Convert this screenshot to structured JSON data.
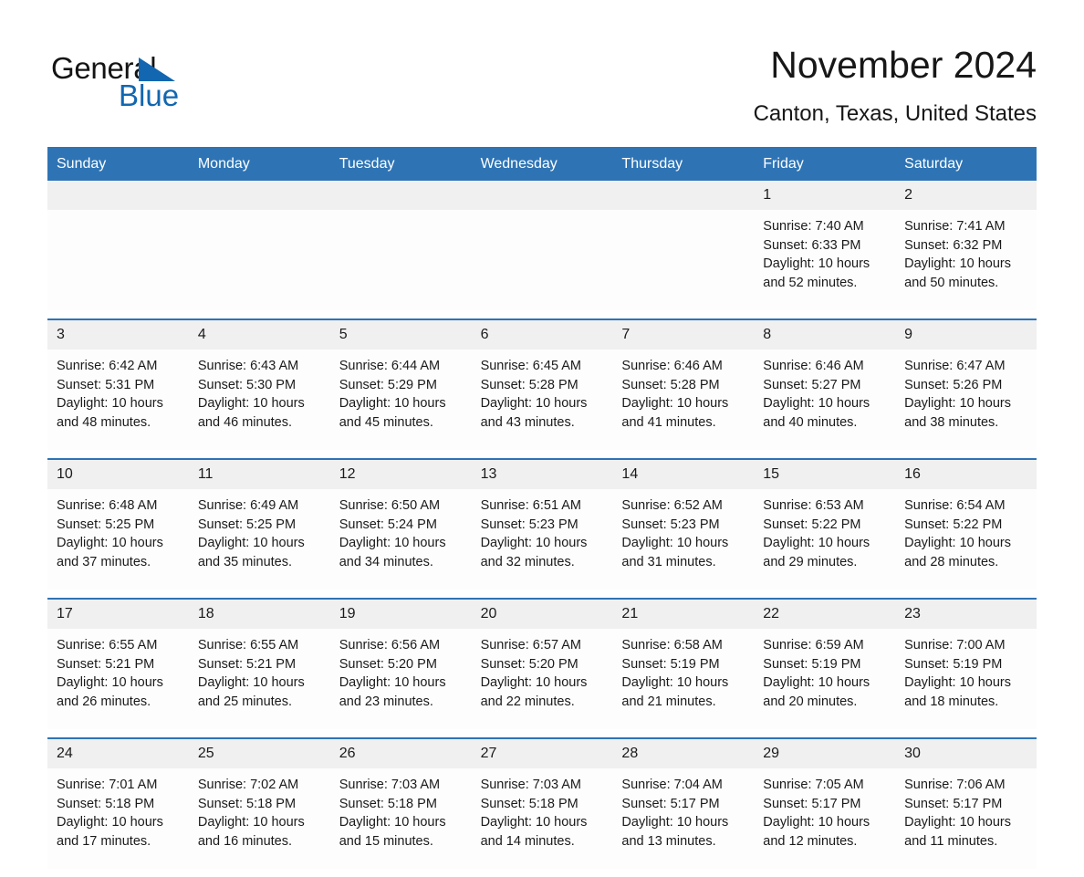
{
  "brand": {
    "name_part1": "General",
    "name_part2": "Blue",
    "accent_color": "#1267b0"
  },
  "header": {
    "title": "November 2024",
    "subtitle": "Canton, Texas, United States",
    "header_bg_color": "#2e74b5",
    "daynum_bg_color": "#f0f0f0"
  },
  "weekday_headers": [
    "Sunday",
    "Monday",
    "Tuesday",
    "Wednesday",
    "Thursday",
    "Friday",
    "Saturday"
  ],
  "weeks": [
    {
      "days": [
        {
          "num": "",
          "lines": []
        },
        {
          "num": "",
          "lines": []
        },
        {
          "num": "",
          "lines": []
        },
        {
          "num": "",
          "lines": []
        },
        {
          "num": "",
          "lines": []
        },
        {
          "num": "1",
          "lines": [
            "Sunrise: 7:40 AM",
            "Sunset: 6:33 PM",
            "Daylight: 10 hours",
            "and 52 minutes."
          ]
        },
        {
          "num": "2",
          "lines": [
            "Sunrise: 7:41 AM",
            "Sunset: 6:32 PM",
            "Daylight: 10 hours",
            "and 50 minutes."
          ]
        }
      ]
    },
    {
      "days": [
        {
          "num": "3",
          "lines": [
            "Sunrise: 6:42 AM",
            "Sunset: 5:31 PM",
            "Daylight: 10 hours",
            "and 48 minutes."
          ]
        },
        {
          "num": "4",
          "lines": [
            "Sunrise: 6:43 AM",
            "Sunset: 5:30 PM",
            "Daylight: 10 hours",
            "and 46 minutes."
          ]
        },
        {
          "num": "5",
          "lines": [
            "Sunrise: 6:44 AM",
            "Sunset: 5:29 PM",
            "Daylight: 10 hours",
            "and 45 minutes."
          ]
        },
        {
          "num": "6",
          "lines": [
            "Sunrise: 6:45 AM",
            "Sunset: 5:28 PM",
            "Daylight: 10 hours",
            "and 43 minutes."
          ]
        },
        {
          "num": "7",
          "lines": [
            "Sunrise: 6:46 AM",
            "Sunset: 5:28 PM",
            "Daylight: 10 hours",
            "and 41 minutes."
          ]
        },
        {
          "num": "8",
          "lines": [
            "Sunrise: 6:46 AM",
            "Sunset: 5:27 PM",
            "Daylight: 10 hours",
            "and 40 minutes."
          ]
        },
        {
          "num": "9",
          "lines": [
            "Sunrise: 6:47 AM",
            "Sunset: 5:26 PM",
            "Daylight: 10 hours",
            "and 38 minutes."
          ]
        }
      ]
    },
    {
      "days": [
        {
          "num": "10",
          "lines": [
            "Sunrise: 6:48 AM",
            "Sunset: 5:25 PM",
            "Daylight: 10 hours",
            "and 37 minutes."
          ]
        },
        {
          "num": "11",
          "lines": [
            "Sunrise: 6:49 AM",
            "Sunset: 5:25 PM",
            "Daylight: 10 hours",
            "and 35 minutes."
          ]
        },
        {
          "num": "12",
          "lines": [
            "Sunrise: 6:50 AM",
            "Sunset: 5:24 PM",
            "Daylight: 10 hours",
            "and 34 minutes."
          ]
        },
        {
          "num": "13",
          "lines": [
            "Sunrise: 6:51 AM",
            "Sunset: 5:23 PM",
            "Daylight: 10 hours",
            "and 32 minutes."
          ]
        },
        {
          "num": "14",
          "lines": [
            "Sunrise: 6:52 AM",
            "Sunset: 5:23 PM",
            "Daylight: 10 hours",
            "and 31 minutes."
          ]
        },
        {
          "num": "15",
          "lines": [
            "Sunrise: 6:53 AM",
            "Sunset: 5:22 PM",
            "Daylight: 10 hours",
            "and 29 minutes."
          ]
        },
        {
          "num": "16",
          "lines": [
            "Sunrise: 6:54 AM",
            "Sunset: 5:22 PM",
            "Daylight: 10 hours",
            "and 28 minutes."
          ]
        }
      ]
    },
    {
      "days": [
        {
          "num": "17",
          "lines": [
            "Sunrise: 6:55 AM",
            "Sunset: 5:21 PM",
            "Daylight: 10 hours",
            "and 26 minutes."
          ]
        },
        {
          "num": "18",
          "lines": [
            "Sunrise: 6:55 AM",
            "Sunset: 5:21 PM",
            "Daylight: 10 hours",
            "and 25 minutes."
          ]
        },
        {
          "num": "19",
          "lines": [
            "Sunrise: 6:56 AM",
            "Sunset: 5:20 PM",
            "Daylight: 10 hours",
            "and 23 minutes."
          ]
        },
        {
          "num": "20",
          "lines": [
            "Sunrise: 6:57 AM",
            "Sunset: 5:20 PM",
            "Daylight: 10 hours",
            "and 22 minutes."
          ]
        },
        {
          "num": "21",
          "lines": [
            "Sunrise: 6:58 AM",
            "Sunset: 5:19 PM",
            "Daylight: 10 hours",
            "and 21 minutes."
          ]
        },
        {
          "num": "22",
          "lines": [
            "Sunrise: 6:59 AM",
            "Sunset: 5:19 PM",
            "Daylight: 10 hours",
            "and 20 minutes."
          ]
        },
        {
          "num": "23",
          "lines": [
            "Sunrise: 7:00 AM",
            "Sunset: 5:19 PM",
            "Daylight: 10 hours",
            "and 18 minutes."
          ]
        }
      ]
    },
    {
      "days": [
        {
          "num": "24",
          "lines": [
            "Sunrise: 7:01 AM",
            "Sunset: 5:18 PM",
            "Daylight: 10 hours",
            "and 17 minutes."
          ]
        },
        {
          "num": "25",
          "lines": [
            "Sunrise: 7:02 AM",
            "Sunset: 5:18 PM",
            "Daylight: 10 hours",
            "and 16 minutes."
          ]
        },
        {
          "num": "26",
          "lines": [
            "Sunrise: 7:03 AM",
            "Sunset: 5:18 PM",
            "Daylight: 10 hours",
            "and 15 minutes."
          ]
        },
        {
          "num": "27",
          "lines": [
            "Sunrise: 7:03 AM",
            "Sunset: 5:18 PM",
            "Daylight: 10 hours",
            "and 14 minutes."
          ]
        },
        {
          "num": "28",
          "lines": [
            "Sunrise: 7:04 AM",
            "Sunset: 5:17 PM",
            "Daylight: 10 hours",
            "and 13 minutes."
          ]
        },
        {
          "num": "29",
          "lines": [
            "Sunrise: 7:05 AM",
            "Sunset: 5:17 PM",
            "Daylight: 10 hours",
            "and 12 minutes."
          ]
        },
        {
          "num": "30",
          "lines": [
            "Sunrise: 7:06 AM",
            "Sunset: 5:17 PM",
            "Daylight: 10 hours",
            "and 11 minutes."
          ]
        }
      ]
    }
  ]
}
